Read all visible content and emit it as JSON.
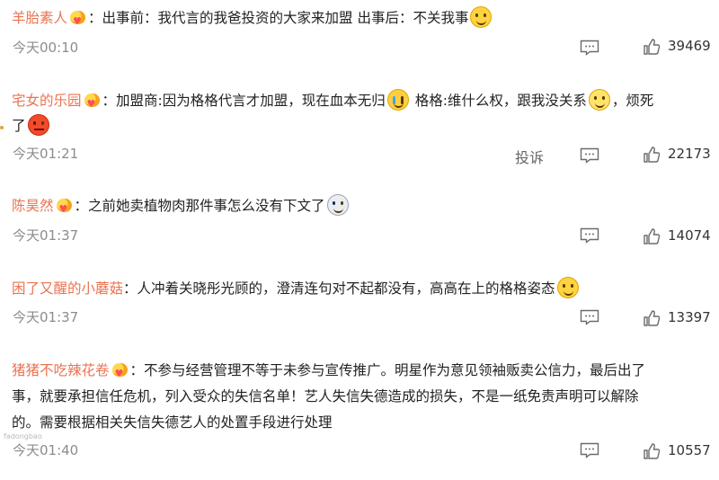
{
  "comments": [
    {
      "user": "羊胎素人",
      "parts": [
        "：出事前：我代言的我爸投资的大家来加盟 出事后：不关我事"
      ],
      "time": "今天00:10",
      "likes": "39469"
    },
    {
      "user": "宅女的乐园",
      "line1a": "：加盟商:因为格格代言才加盟，现在血本无归",
      "line1b": "格格:维什么权，跟我没关系",
      "line1c": "，烦死",
      "line2": "了",
      "time": "今天01:21",
      "report": "投诉",
      "likes": "22173"
    },
    {
      "user": "陈昊然",
      "parts": [
        "：之前她卖植物肉那件事怎么没有下文了"
      ],
      "time": "今天01:37",
      "likes": "14074"
    },
    {
      "user": "困了又醒的小蘑菇",
      "parts": [
        "：人冲着关晓彤光顾的，澄清连句对不起都没有，高高在上的格格姿态"
      ],
      "time": "今天01:37",
      "likes": "13397"
    },
    {
      "user": "猪猪不吃辣花卷",
      "line1": "：不参与经营管理不等于未参与宣传推广。明星作为意见领袖贩卖公信力，最后出了",
      "line2": "事，就要承担信任危机，列入受众的失信名单！艺人失信失德造成的损失，不是一纸免责声明可以解除",
      "line3": "的。需要根据相关失信失德艺人的处置手段进行处理",
      "time": "今天01:40",
      "likes": "10557"
    }
  ],
  "icons": {
    "comment": "comment-icon",
    "like": "thumbs-up-icon",
    "badge": "heart-badge-icon"
  },
  "watermark": "fadongbao"
}
